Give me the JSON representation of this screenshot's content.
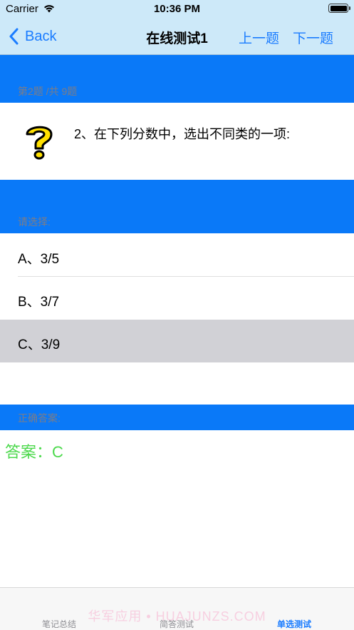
{
  "status_bar": {
    "carrier": "Carrier",
    "time": "10:36 PM",
    "wifi_icon": "wifi-icon",
    "battery_icon": "battery-icon"
  },
  "nav": {
    "back_label": "Back",
    "title": "在线测试1",
    "prev_label": "上一题",
    "next_label": "下一题",
    "accent_color": "#1a7cff",
    "background_color": "#cde9f9"
  },
  "progress_label": "第2题 /共 9题",
  "question": {
    "icon": "question-mark-icon",
    "text": "2、在下列分数中，选出不同类的一项:"
  },
  "choose_label": "请选择:",
  "options": [
    {
      "label": "A、3/5",
      "selected": false
    },
    {
      "label": "B、3/7",
      "selected": false
    },
    {
      "label": "C、3/9",
      "selected": true
    }
  ],
  "correct_label": "正确答案:",
  "answer": {
    "text": "答案：C",
    "color": "#4cd94c"
  },
  "section_color": "#0a79f8",
  "tabs": [
    {
      "label": "笔记总结",
      "active": false
    },
    {
      "label": "简答测试",
      "active": false
    },
    {
      "label": "单选测试",
      "active": true
    }
  ],
  "watermark": "华军应用 • HUAJUNZS.COM"
}
